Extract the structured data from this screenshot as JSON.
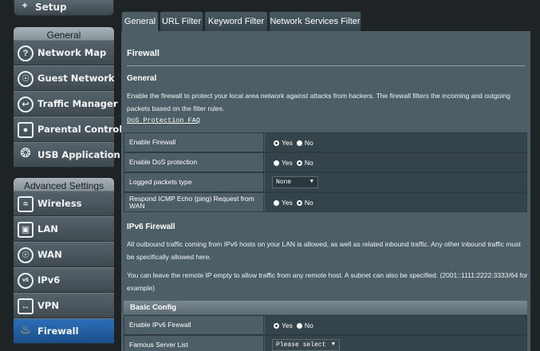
{
  "sidebar": {
    "setup_label": "Setup",
    "general_header": "General",
    "general_items": [
      {
        "label": "Network Map",
        "icon": "network-map-icon"
      },
      {
        "label": "Guest Network",
        "icon": "globe-icon"
      },
      {
        "label": "Traffic Manager",
        "icon": "gauge-icon"
      },
      {
        "label": "Parental Controls",
        "icon": "lock-icon"
      },
      {
        "label": "USB Application",
        "icon": "puzzle-icon"
      }
    ],
    "advanced_header": "Advanced Settings",
    "advanced_items": [
      {
        "label": "Wireless",
        "icon": "wifi-icon"
      },
      {
        "label": "LAN",
        "icon": "monitor-icon"
      },
      {
        "label": "WAN",
        "icon": "globe-icon"
      },
      {
        "label": "IPv6",
        "icon": "ipv6-icon"
      },
      {
        "label": "VPN",
        "icon": "vpn-icon"
      },
      {
        "label": "Firewall",
        "icon": "firewall-icon",
        "active": true
      }
    ]
  },
  "tabs": [
    "General",
    "URL Filter",
    "Keyword Filter",
    "Network Services Filter"
  ],
  "page_title": "Firewall",
  "general": {
    "title": "General",
    "description": "Enable the firewall to protect your local area network against attacks from hackers. The firewall filters the incoming and outgoing packets based on the filter rules.",
    "faq_link": "DoS Protection FAQ"
  },
  "settings": [
    {
      "label": "Enable Firewall",
      "type": "radio",
      "yes": "Yes",
      "no": "No",
      "selected": "Yes"
    },
    {
      "label": "Enable DoS protection",
      "type": "radio",
      "yes": "Yes",
      "no": "No",
      "selected": "No"
    },
    {
      "label": "Logged packets type",
      "type": "select",
      "value": "None"
    },
    {
      "label": "Respond ICMP Echo (ping) Request from WAN",
      "type": "radio",
      "yes": "Yes",
      "no": "No",
      "selected": "No"
    }
  ],
  "ipv6": {
    "title": "IPv6 Firewall",
    "para1": "All outbound traffic coming from IPv6 hosts on your LAN is allowed, as well as related inbound traffic. Any other inbound traffic must be specifically allowed here.",
    "para2": "You can leave the remote IP empty to allow traffic from any remote host. A subnet can also be specified. (2001::1111:2222:3333/64 for example)",
    "basic_config": "Basic Config",
    "rows": [
      {
        "label": "Enable IPv6 Firewall",
        "type": "radio",
        "yes": "Yes",
        "no": "No",
        "selected": "Yes"
      },
      {
        "label": "Famous Server List",
        "type": "select",
        "value": "Please select"
      }
    ]
  },
  "colors": {
    "accent": "#1b4f8a",
    "panel": "#4d5e66",
    "value_cell": "#35434a"
  }
}
